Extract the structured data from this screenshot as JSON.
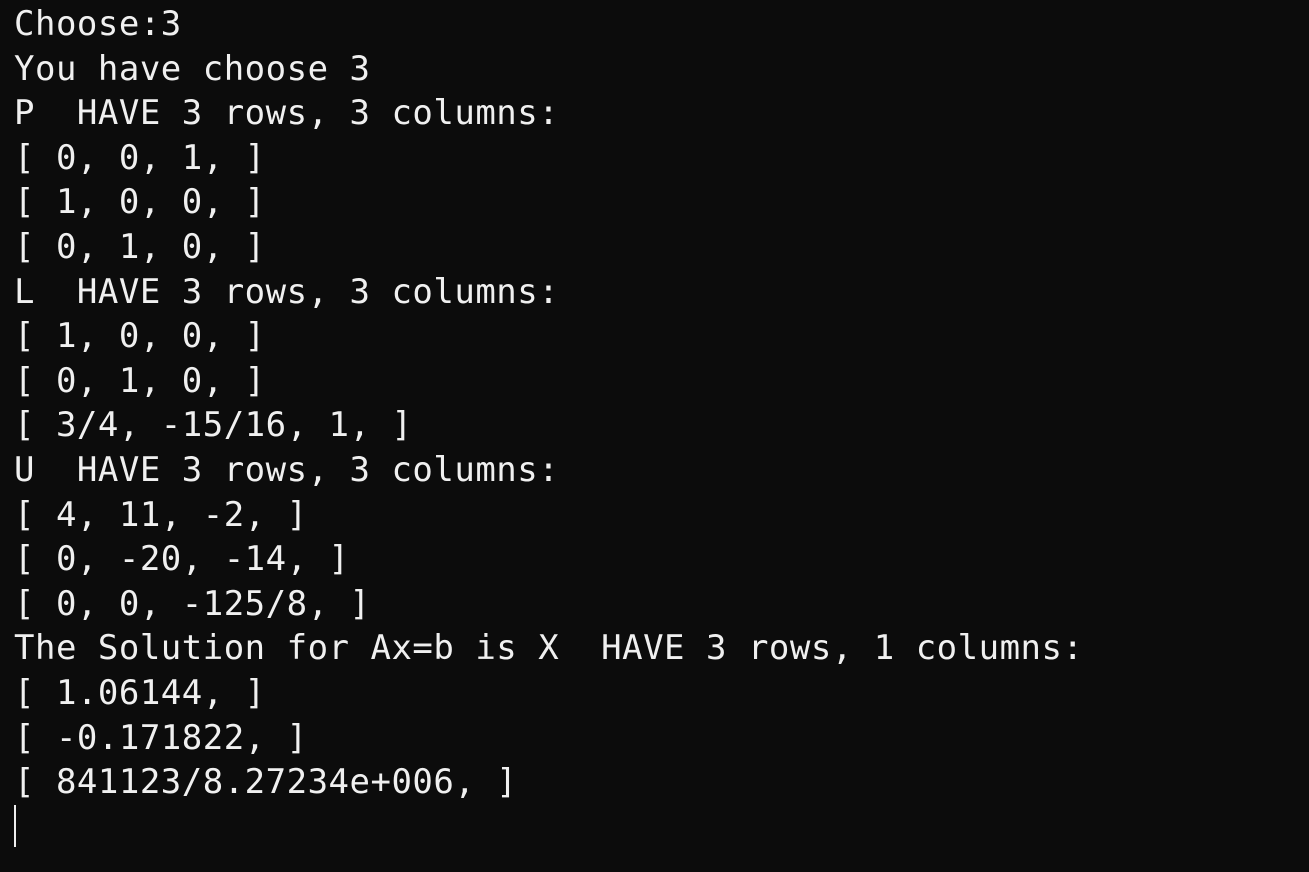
{
  "console": {
    "lines": [
      "Choose:3",
      "You have choose 3",
      "P  HAVE 3 rows, 3 columns:",
      "[ 0, 0, 1, ]",
      "[ 1, 0, 0, ]",
      "[ 0, 1, 0, ]",
      "L  HAVE 3 rows, 3 columns:",
      "[ 1, 0, 0, ]",
      "[ 0, 1, 0, ]",
      "[ 3/4, -15/16, 1, ]",
      "U  HAVE 3 rows, 3 columns:",
      "[ 4, 11, -2, ]",
      "[ 0, -20, -14, ]",
      "[ 0, 0, -125/8, ]",
      "The Solution for Ax=b is X  HAVE 3 rows, 1 columns:",
      "[ 1.06144, ]",
      "[ -0.171822, ]",
      "[ 841123/8.27234e+006, ]"
    ],
    "colors": {
      "background": "#0c0c0c",
      "foreground": "#f0f0f0"
    }
  }
}
